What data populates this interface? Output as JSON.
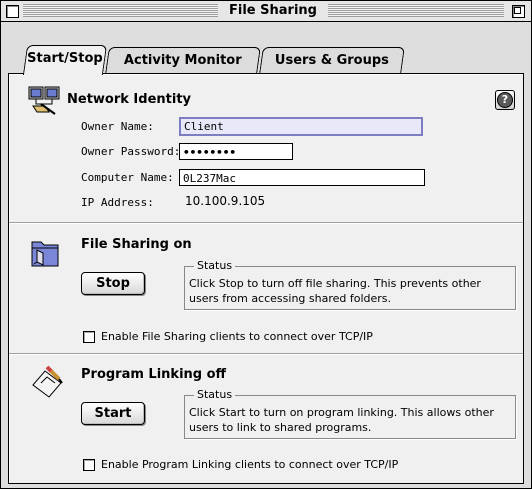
{
  "window": {
    "title": "File Sharing"
  },
  "tabs": [
    {
      "label": "Start/Stop",
      "active": true
    },
    {
      "label": "Activity Monitor",
      "active": false
    },
    {
      "label": "Users & Groups",
      "active": false
    }
  ],
  "network_identity": {
    "heading": "Network Identity",
    "owner_name_label": "Owner Name:",
    "owner_name_value": "Client",
    "owner_password_label": "Owner Password:",
    "owner_password_value": "••••••••",
    "computer_name_label": "Computer Name:",
    "computer_name_value": "0L237Mac",
    "ip_address_label": "IP Address:",
    "ip_address_value": "10.100.9.105",
    "help_label": "?"
  },
  "file_sharing": {
    "heading": "File Sharing on",
    "button_label": "Stop",
    "status_label": "Status",
    "status_line1": "Click Stop to turn off file sharing. This prevents other",
    "status_line2": "users from accessing shared folders.",
    "checkbox_label": "Enable File Sharing clients to connect over TCP/IP",
    "checkbox_checked": false
  },
  "program_linking": {
    "heading": "Program Linking off",
    "button_label": "Start",
    "status_label": "Status",
    "status_line1": "Click Start to turn on program linking. This allows other",
    "status_line2": "users to link to shared programs.",
    "checkbox_label": "Enable Program Linking clients to connect over TCP/IP",
    "checkbox_checked": false
  },
  "icons": {
    "network": "network-identity-icon",
    "folder": "shared-folder-icon",
    "linking": "program-linking-icon"
  },
  "colors": {
    "panel_bg": "#f0f0f0",
    "window_bg": "#dedede",
    "focus_border": "#7d7dc2"
  }
}
